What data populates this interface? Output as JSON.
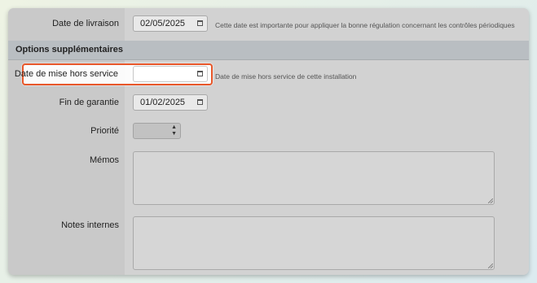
{
  "fields": {
    "delivery_date": {
      "label": "Date de livraison",
      "value": "02/05/2025",
      "hint": "Cette date est importante pour appliquer la bonne régulation concernant les contrôles périodiques"
    },
    "section_title": "Options supplémentaires",
    "decommission_date": {
      "label": "Date de mise hors service",
      "value": "",
      "hint": "Date de mise hors service de cette installation"
    },
    "warranty_end": {
      "label": "Fin de garantie",
      "value": "01/02/2025"
    },
    "priority": {
      "label": "Priorité",
      "selected": ""
    },
    "memos": {
      "label": "Mémos",
      "value": ""
    },
    "internal_notes": {
      "label": "Notes internes",
      "value": ""
    }
  },
  "colors": {
    "highlight": "#e8572a",
    "section_bg": "#b9bec2"
  },
  "icons": {
    "calendar": "calendar-icon",
    "select_arrows": "updown-arrows-icon",
    "resize": "resize-grip-icon"
  }
}
